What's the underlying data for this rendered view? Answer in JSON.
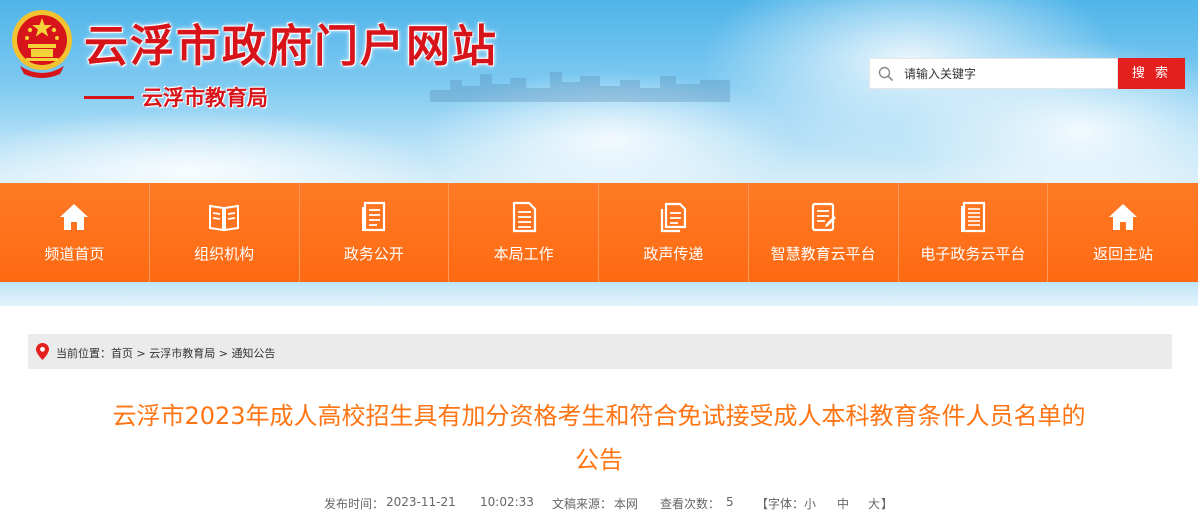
{
  "header": {
    "site_title": "云浮市政府门户网站",
    "sub_title": "云浮市教育局",
    "search": {
      "placeholder": "请输入关键字",
      "button_label": "搜 索"
    }
  },
  "nav": {
    "items": [
      {
        "label": "频道首页",
        "icon": "home-icon"
      },
      {
        "label": "组织机构",
        "icon": "book-icon"
      },
      {
        "label": "政务公开",
        "icon": "document-icon"
      },
      {
        "label": "本局工作",
        "icon": "file-list-icon"
      },
      {
        "label": "政声传递",
        "icon": "copy-doc-icon"
      },
      {
        "label": "智慧教育云平台",
        "icon": "notepad-icon"
      },
      {
        "label": "电子政务云平台",
        "icon": "lined-doc-icon"
      },
      {
        "label": "返回主站",
        "icon": "home-icon"
      }
    ]
  },
  "breadcrumb": {
    "prefix": "当前位置：",
    "items": [
      "首页",
      "云浮市教育局",
      "通知公告"
    ],
    "separator": " > "
  },
  "article": {
    "title_line1": "云浮市2023年成人高校招生具有加分资格考生和符合免试接受成人本科教育条件人员名单的",
    "title_line2": "公告",
    "meta": {
      "publish_label": "发布时间：",
      "date": "2023-11-21",
      "time": "10:02:33",
      "source_label": "文稿来源：",
      "source": "本网",
      "views_label": "查看次数：",
      "views": "5",
      "font_size_label": "【字体：",
      "font_small": "小",
      "font_medium": "中",
      "font_large": "大",
      "font_close": "】"
    }
  },
  "colors": {
    "brand_red": "#d8141b",
    "nav_orange": "#fd6a12",
    "title_orange": "#ff7413",
    "search_button": "#e4201f"
  }
}
